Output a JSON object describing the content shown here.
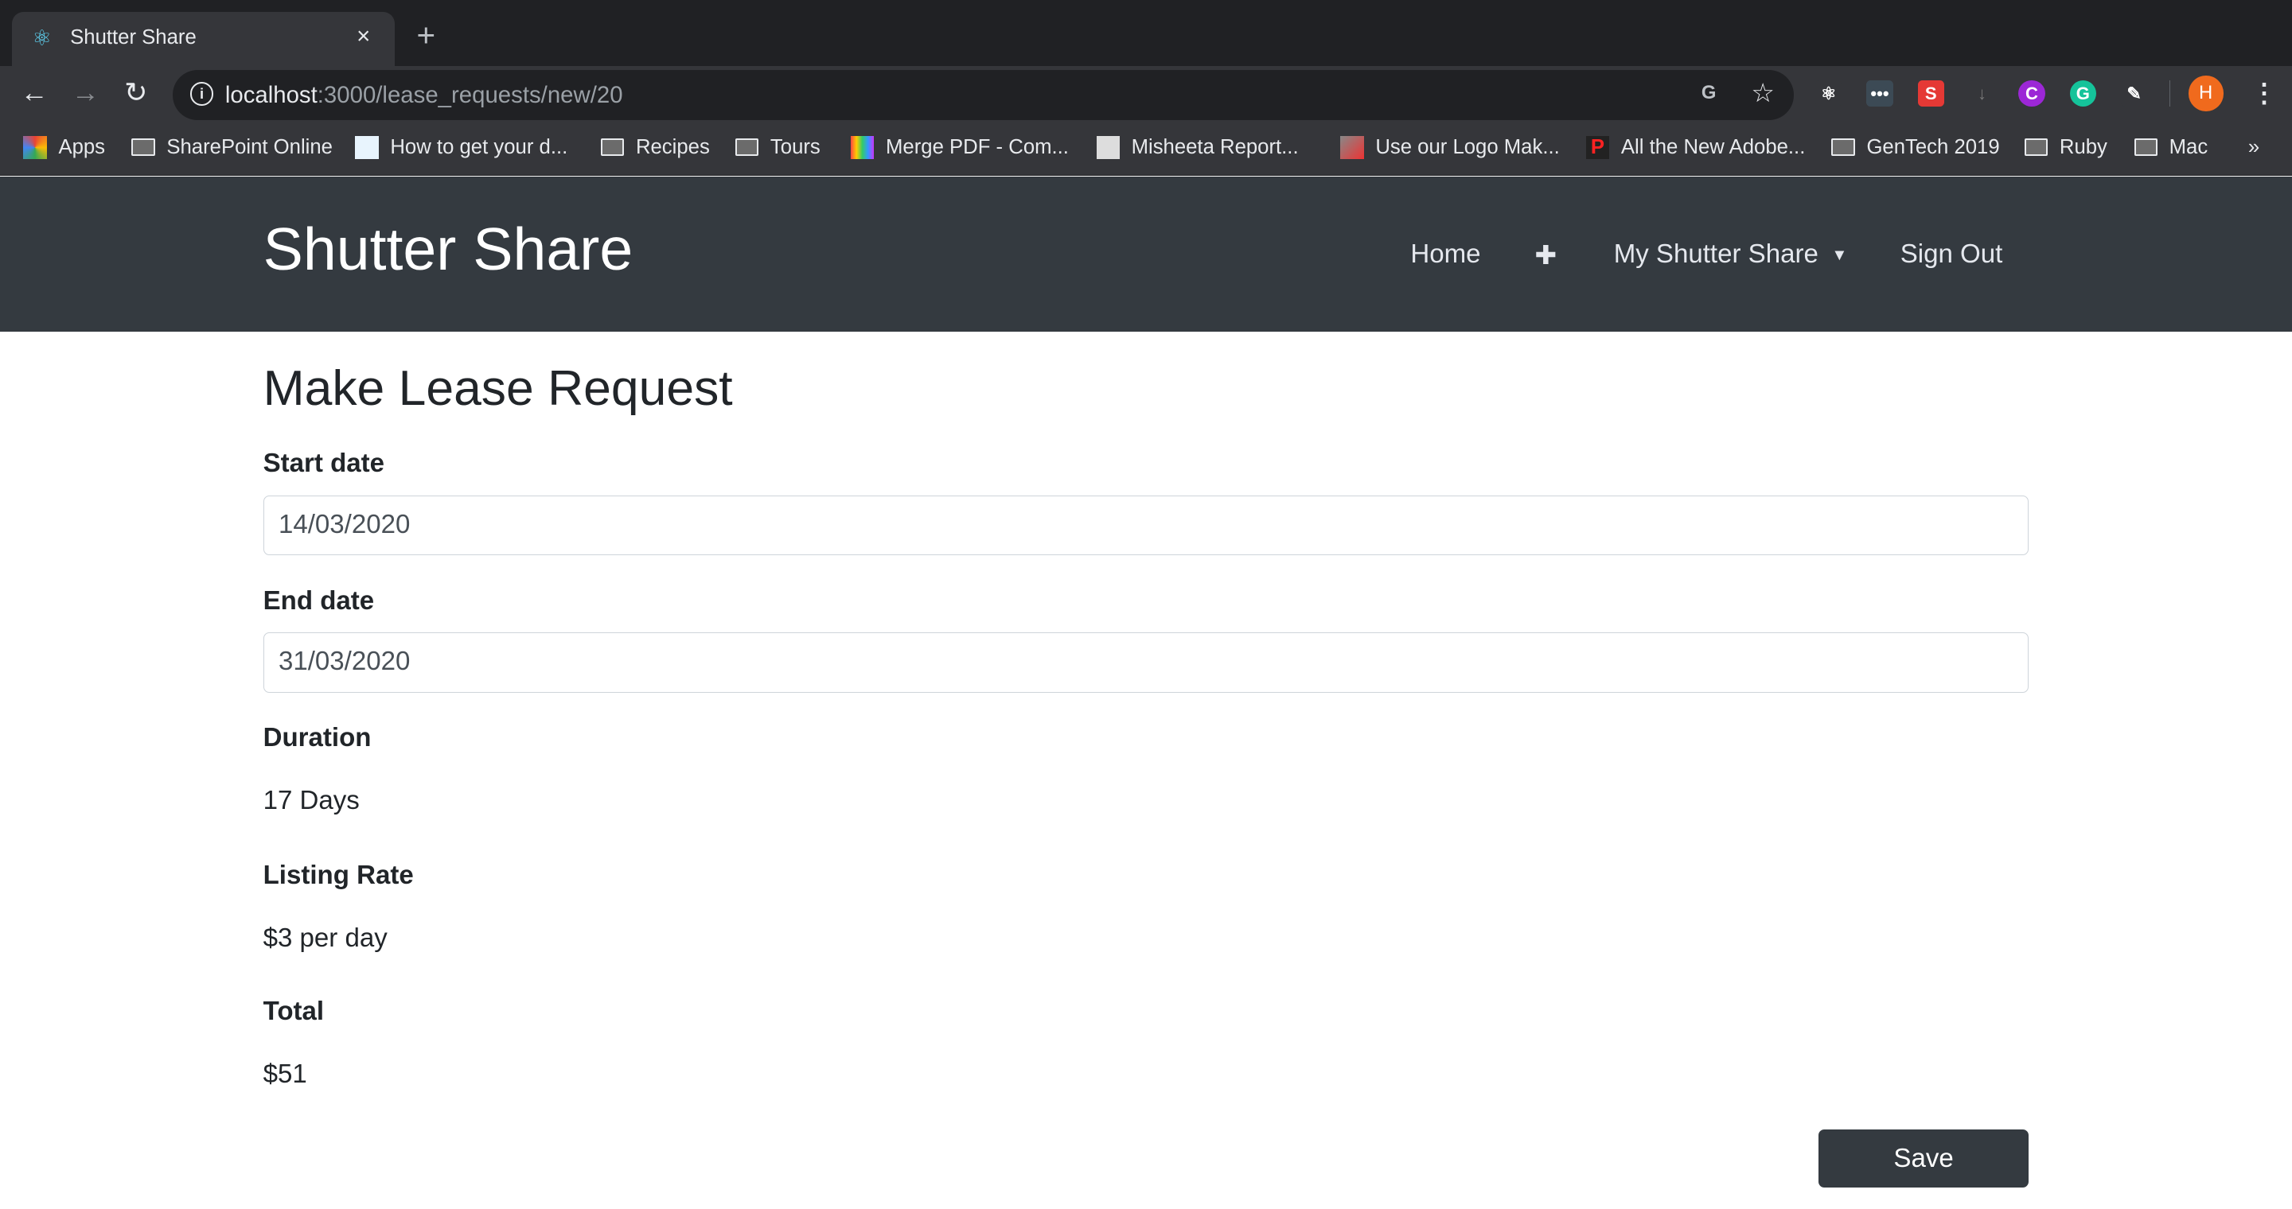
{
  "browser": {
    "tab_title": "Shutter Share",
    "tab_close": "×",
    "new_tab": "+",
    "url_host": "localhost",
    "url_rest": ":3000/lease_requests/new/20",
    "nav": {
      "back": "←",
      "forward": "→",
      "reload": "↻"
    },
    "bookmarks": [
      {
        "label": "Apps",
        "icon": "apps-grid-icon"
      },
      {
        "label": "SharePoint Online",
        "icon": "folder-icon"
      },
      {
        "label": "How to get your d...",
        "icon": "page-icon"
      },
      {
        "label": "Recipes",
        "icon": "folder-icon"
      },
      {
        "label": "Tours",
        "icon": "folder-icon"
      },
      {
        "label": "Merge PDF - Com...",
        "icon": "merge-pdf-icon"
      },
      {
        "label": "Misheeta Report...",
        "icon": "misheeta-icon"
      },
      {
        "label": "Use our Logo Mak...",
        "icon": "logo-maker-icon"
      },
      {
        "label": "All the New Adobe...",
        "icon": "p-logo-icon"
      },
      {
        "label": "GenTech 2019",
        "icon": "folder-icon"
      },
      {
        "label": "Ruby",
        "icon": "folder-icon"
      },
      {
        "label": "Mac",
        "icon": "folder-icon"
      }
    ],
    "bookmarks_overflow": "»",
    "extensions": [
      {
        "name": "react-devtools-icon",
        "glyph": "⚛",
        "color": "#35363a"
      },
      {
        "name": "lastpass-icon",
        "glyph": "•••",
        "color": "#3c4a55"
      },
      {
        "name": "s-extension-icon",
        "glyph": "S",
        "color": "#e53935"
      },
      {
        "name": "download-icon",
        "glyph": "↓",
        "color": "#35363a"
      },
      {
        "name": "c-extension-icon",
        "glyph": "C",
        "color": "#9c27d6"
      },
      {
        "name": "grammarly-icon",
        "glyph": "G",
        "color": "#15c39a"
      },
      {
        "name": "eyedropper-icon",
        "glyph": "✎",
        "color": "#35363a"
      }
    ],
    "profile_initial": "H",
    "profile_color": "#f06a1d"
  },
  "navbar": {
    "brand": "Shutter Share",
    "home": "Home",
    "add": "✚",
    "my_shutter_share": "My Shutter Share",
    "sign_out": "Sign Out",
    "bg_color": "#343a40"
  },
  "form": {
    "title": "Make Lease Request",
    "start_date_label": "Start date",
    "start_date_value": "14/03/2020",
    "end_date_label": "End date",
    "end_date_value": "31/03/2020",
    "duration_label": "Duration",
    "duration_value": "17 Days",
    "rate_label": "Listing Rate",
    "rate_value": "$3 per day",
    "total_label": "Total",
    "total_value": "$51",
    "save_label": "Save"
  }
}
